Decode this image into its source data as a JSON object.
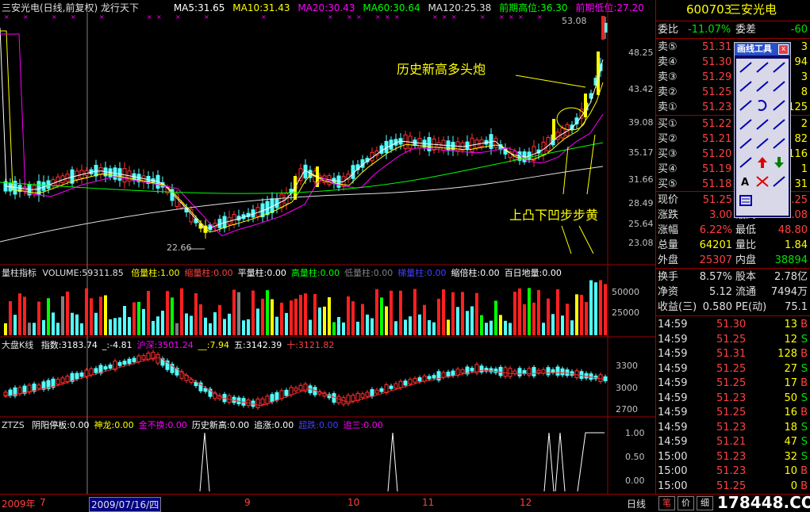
{
  "header": {
    "stock_title": "三安光电(日线,前复权) 龙行天下",
    "ma5": "MA5:31.65",
    "ma10": "MA10:31.43",
    "ma20": "MA20:30.43",
    "ma60": "MA60:30.64",
    "ma120": "MA120:25.38",
    "prev_high": "前期高位:36.30",
    "prev_low": "前期低位:27.20"
  },
  "main_chart": {
    "price_labels": [
      "48.25",
      "43.42",
      "39.08",
      "35.17",
      "31.66",
      "28.49",
      "25.64",
      "23.08"
    ],
    "high_mark": "53.08",
    "low_mark": "22.66",
    "annotation1": "历史新高多头炮",
    "annotation2": "上凸下凹步步黄"
  },
  "volume_panel": {
    "label": "量柱指标",
    "volume": "VOLUME:59311.85",
    "items": [
      {
        "text": "倍量柱:1.00",
        "color": "#ffff00"
      },
      {
        "text": "缩量柱:0.00",
        "color": "#ff4040"
      },
      {
        "text": "平量柱:0.00",
        "color": "#ffffff"
      },
      {
        "text": "高量柱:0.00",
        "color": "#00ff00"
      },
      {
        "text": "低量柱:0.00",
        "color": "#808080"
      },
      {
        "text": "梯量柱:0.00",
        "color": "#4040ff"
      },
      {
        "text": "缩倍柱:0.00",
        "color": "#ffffff"
      },
      {
        "text": "百日地量:0.00",
        "color": "#ffffff"
      }
    ],
    "axis_labels": [
      "50000",
      "25000"
    ]
  },
  "index_panel": {
    "label": "大盘K线",
    "items": [
      {
        "text": "指数:3183.74",
        "color": "#ffffff"
      },
      {
        "text": "_:-4.81",
        "color": "#ffffff"
      },
      {
        "text": "沪深:3501.24",
        "color": "#ff00ff"
      },
      {
        "text": "__:7.94",
        "color": "#ffff00"
      },
      {
        "text": "五:3142.39",
        "color": "#ffffff"
      },
      {
        "text": "十:3121.82",
        "color": "#ff4040"
      }
    ],
    "axis_labels": [
      "3300",
      "3000",
      "2700"
    ]
  },
  "ztzs_panel": {
    "label": "ZTZS",
    "items": [
      {
        "text": "阴阳停板:0.00",
        "color": "#ffffff"
      },
      {
        "text": "神龙:0.00",
        "color": "#ffff00"
      },
      {
        "text": "金不换:0.00",
        "color": "#ff00ff"
      },
      {
        "text": "历史新高:0.00",
        "color": "#ffffff"
      },
      {
        "text": "追涨:0.00",
        "color": "#ffffff"
      },
      {
        "text": "超跌:0.00",
        "color": "#4040ff"
      },
      {
        "text": "追三:0.00",
        "color": "#ff00ff"
      }
    ],
    "axis_labels": [
      "1.00",
      "0.50",
      "0.00"
    ]
  },
  "date_axis": {
    "labels": [
      "2009年",
      "7",
      "2009/07/16/四",
      "9",
      "10",
      "11",
      "12"
    ],
    "period": "日线"
  },
  "quote": {
    "code": "600703",
    "name": "三安光电",
    "webi_label": "委比",
    "webi_value": "-11.07%",
    "wecha_label": "委差",
    "wecha_value": "-60",
    "sells": [
      {
        "label": "卖⑤",
        "price": "51.31",
        "vol": "3"
      },
      {
        "label": "卖④",
        "price": "51.30",
        "vol": "94"
      },
      {
        "label": "卖③",
        "price": "51.29",
        "vol": "3"
      },
      {
        "label": "卖②",
        "price": "51.25",
        "vol": "8"
      },
      {
        "label": "卖①",
        "price": "51.23",
        "vol": "125"
      }
    ],
    "buys": [
      {
        "label": "买①",
        "price": "51.22",
        "vol": "2"
      },
      {
        "label": "买②",
        "price": "51.21",
        "vol": "82"
      },
      {
        "label": "买③",
        "price": "51.20",
        "vol": "116"
      },
      {
        "label": "买④",
        "price": "51.19",
        "vol": "1"
      },
      {
        "label": "买⑤",
        "price": "51.18",
        "vol": "31"
      }
    ],
    "stats": [
      {
        "l1": "现价",
        "v1": "51.25",
        "l2": "今开",
        "v2": "48.25"
      },
      {
        "l1": "涨跌",
        "v1": "3.00",
        "l2": "最高",
        "v2": "53.08"
      },
      {
        "l1": "涨幅",
        "v1": "6.22%",
        "l2": "最低",
        "v2": "48.80"
      },
      {
        "l1": "总量",
        "v1": "64201",
        "l2": "量比",
        "v2": "1.84"
      },
      {
        "l1": "外盘",
        "v1": "25307",
        "l2": "内盘",
        "v2": "38894"
      }
    ],
    "extra": [
      {
        "l1": "换手",
        "v1": "8.57%",
        "l2": "股本",
        "v2": "2.78亿"
      },
      {
        "l1": "净资",
        "v1": "5.12",
        "l2": "流通",
        "v2": "7494万"
      },
      {
        "l1": "收益(三)",
        "v1": "0.580",
        "l2": "PE(动)",
        "v2": "75.1"
      }
    ],
    "ticks": [
      {
        "time": "14:59",
        "price": "51.30",
        "vol": "13",
        "bs": "B"
      },
      {
        "time": "14:59",
        "price": "51.25",
        "vol": "12",
        "bs": "S"
      },
      {
        "time": "14:59",
        "price": "51.31",
        "vol": "128",
        "bs": "B"
      },
      {
        "time": "14:59",
        "price": "51.25",
        "vol": "27",
        "bs": "S"
      },
      {
        "time": "14:59",
        "price": "51.25",
        "vol": "17",
        "bs": "B"
      },
      {
        "time": "14:59",
        "price": "51.23",
        "vol": "50",
        "bs": "S"
      },
      {
        "time": "14:59",
        "price": "51.25",
        "vol": "16",
        "bs": "B"
      },
      {
        "time": "14:59",
        "price": "51.23",
        "vol": "18",
        "bs": "S"
      },
      {
        "time": "14:59",
        "price": "51.21",
        "vol": "47",
        "bs": "S"
      },
      {
        "time": "15:00",
        "price": "51.23",
        "vol": "32",
        "bs": "S"
      },
      {
        "time": "15:00",
        "price": "51.23",
        "vol": "10",
        "bs": "B"
      },
      {
        "time": "15:00",
        "price": "51.25",
        "vol": "0",
        "bs": "B"
      }
    ]
  },
  "draw_tool": {
    "title": "画线工具",
    "close": "x"
  },
  "bottom_tabs": [
    "笔",
    "价",
    "细"
  ],
  "watermark": "178448.COM",
  "colors": {
    "up": "#ff3232",
    "down": "#54ffff",
    "border": "#a00000",
    "yellow": "#ffff00"
  }
}
